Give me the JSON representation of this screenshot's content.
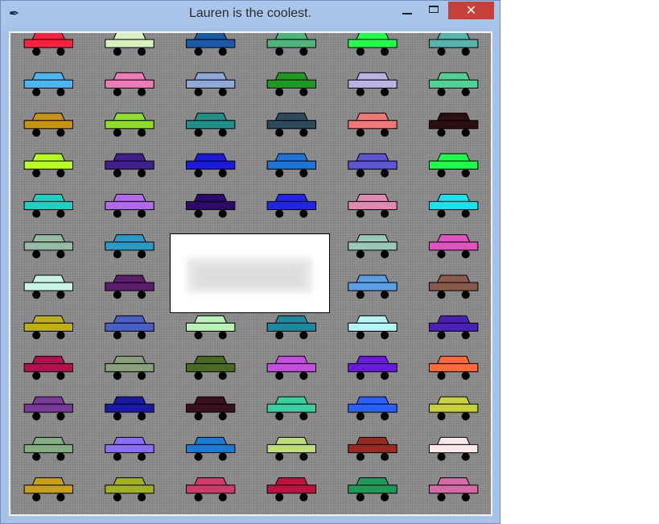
{
  "window": {
    "title": "Lauren is the coolest.",
    "app_icon": "feather-icon",
    "controls": {
      "minimize": "minimize-icon",
      "maximize": "maximize-icon",
      "close": "close-icon",
      "close_glyph": "✕"
    }
  },
  "canvas": {
    "background": "#8a8a8a",
    "cars": [
      [
        "#ff1f3f",
        "#d7f0c0",
        "#1a5aa8",
        "#4db47a",
        "#22ff4a",
        "#57b3ac"
      ],
      [
        "#48b7f3",
        "#f07ab8",
        "#8ea8d8",
        "#1c9a22",
        "#b9b2e3",
        "#4fd394"
      ],
      [
        "#c9920d",
        "#8ede27",
        "#20908a",
        "#2c4a5a",
        "#f27676",
        "#2a1010"
      ],
      [
        "#b8ff1d",
        "#3f1e8e",
        "#1c1adc",
        "#1c74da",
        "#5c55d4",
        "#1aff4a"
      ],
      [
        "#1ed1c4",
        "#b269ee",
        "#2d0a6a",
        "#2224e8",
        "#e18ab1",
        "#14e4ec"
      ],
      [
        "#96bba4",
        "#2a9bc7",
        null,
        null,
        "#99c8b7",
        "#e052c0"
      ],
      [
        "#c8f5e7",
        "#5e1c6c",
        null,
        null,
        "#5b9fe6",
        "#8a5a4c"
      ],
      [
        "#beaf1a",
        "#4a5ec8",
        "#b9f0b8",
        "#1a8aa0",
        "#b3f4f6",
        "#4a20b6"
      ],
      [
        "#b41050",
        "#8aa07c",
        "#4a6a20",
        "#c44ee0",
        "#6a1ade",
        "#ff6a3a"
      ],
      [
        "#7a3a9a",
        "#1a1aa6",
        "#3a1020",
        "#3acfa0",
        "#2a60ff",
        "#c8d240"
      ],
      [
        "#82ac82",
        "#8a6ef6",
        "#1a7ad4",
        "#bedc7a",
        "#9a2a20",
        "#fbe8e8"
      ],
      [
        "#c8a018",
        "#a0b020",
        "#d23a6e",
        "#c01040",
        "#1e9a58",
        "#d66aa6"
      ]
    ]
  },
  "popup": {
    "content": ""
  }
}
